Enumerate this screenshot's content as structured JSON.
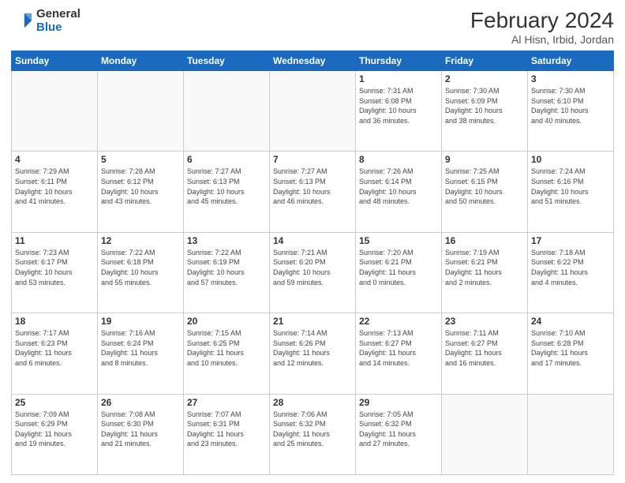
{
  "logo": {
    "general": "General",
    "blue": "Blue"
  },
  "title": "February 2024",
  "subtitle": "Al Hisn, Irbid, Jordan",
  "weekdays": [
    "Sunday",
    "Monday",
    "Tuesday",
    "Wednesday",
    "Thursday",
    "Friday",
    "Saturday"
  ],
  "weeks": [
    [
      {
        "day": "",
        "info": ""
      },
      {
        "day": "",
        "info": ""
      },
      {
        "day": "",
        "info": ""
      },
      {
        "day": "",
        "info": ""
      },
      {
        "day": "1",
        "info": "Sunrise: 7:31 AM\nSunset: 6:08 PM\nDaylight: 10 hours\nand 36 minutes."
      },
      {
        "day": "2",
        "info": "Sunrise: 7:30 AM\nSunset: 6:09 PM\nDaylight: 10 hours\nand 38 minutes."
      },
      {
        "day": "3",
        "info": "Sunrise: 7:30 AM\nSunset: 6:10 PM\nDaylight: 10 hours\nand 40 minutes."
      }
    ],
    [
      {
        "day": "4",
        "info": "Sunrise: 7:29 AM\nSunset: 6:11 PM\nDaylight: 10 hours\nand 41 minutes."
      },
      {
        "day": "5",
        "info": "Sunrise: 7:28 AM\nSunset: 6:12 PM\nDaylight: 10 hours\nand 43 minutes."
      },
      {
        "day": "6",
        "info": "Sunrise: 7:27 AM\nSunset: 6:13 PM\nDaylight: 10 hours\nand 45 minutes."
      },
      {
        "day": "7",
        "info": "Sunrise: 7:27 AM\nSunset: 6:13 PM\nDaylight: 10 hours\nand 46 minutes."
      },
      {
        "day": "8",
        "info": "Sunrise: 7:26 AM\nSunset: 6:14 PM\nDaylight: 10 hours\nand 48 minutes."
      },
      {
        "day": "9",
        "info": "Sunrise: 7:25 AM\nSunset: 6:15 PM\nDaylight: 10 hours\nand 50 minutes."
      },
      {
        "day": "10",
        "info": "Sunrise: 7:24 AM\nSunset: 6:16 PM\nDaylight: 10 hours\nand 51 minutes."
      }
    ],
    [
      {
        "day": "11",
        "info": "Sunrise: 7:23 AM\nSunset: 6:17 PM\nDaylight: 10 hours\nand 53 minutes."
      },
      {
        "day": "12",
        "info": "Sunrise: 7:22 AM\nSunset: 6:18 PM\nDaylight: 10 hours\nand 55 minutes."
      },
      {
        "day": "13",
        "info": "Sunrise: 7:22 AM\nSunset: 6:19 PM\nDaylight: 10 hours\nand 57 minutes."
      },
      {
        "day": "14",
        "info": "Sunrise: 7:21 AM\nSunset: 6:20 PM\nDaylight: 10 hours\nand 59 minutes."
      },
      {
        "day": "15",
        "info": "Sunrise: 7:20 AM\nSunset: 6:21 PM\nDaylight: 11 hours\nand 0 minutes."
      },
      {
        "day": "16",
        "info": "Sunrise: 7:19 AM\nSunset: 6:21 PM\nDaylight: 11 hours\nand 2 minutes."
      },
      {
        "day": "17",
        "info": "Sunrise: 7:18 AM\nSunset: 6:22 PM\nDaylight: 11 hours\nand 4 minutes."
      }
    ],
    [
      {
        "day": "18",
        "info": "Sunrise: 7:17 AM\nSunset: 6:23 PM\nDaylight: 11 hours\nand 6 minutes."
      },
      {
        "day": "19",
        "info": "Sunrise: 7:16 AM\nSunset: 6:24 PM\nDaylight: 11 hours\nand 8 minutes."
      },
      {
        "day": "20",
        "info": "Sunrise: 7:15 AM\nSunset: 6:25 PM\nDaylight: 11 hours\nand 10 minutes."
      },
      {
        "day": "21",
        "info": "Sunrise: 7:14 AM\nSunset: 6:26 PM\nDaylight: 11 hours\nand 12 minutes."
      },
      {
        "day": "22",
        "info": "Sunrise: 7:13 AM\nSunset: 6:27 PM\nDaylight: 11 hours\nand 14 minutes."
      },
      {
        "day": "23",
        "info": "Sunrise: 7:11 AM\nSunset: 6:27 PM\nDaylight: 11 hours\nand 16 minutes."
      },
      {
        "day": "24",
        "info": "Sunrise: 7:10 AM\nSunset: 6:28 PM\nDaylight: 11 hours\nand 17 minutes."
      }
    ],
    [
      {
        "day": "25",
        "info": "Sunrise: 7:09 AM\nSunset: 6:29 PM\nDaylight: 11 hours\nand 19 minutes."
      },
      {
        "day": "26",
        "info": "Sunrise: 7:08 AM\nSunset: 6:30 PM\nDaylight: 11 hours\nand 21 minutes."
      },
      {
        "day": "27",
        "info": "Sunrise: 7:07 AM\nSunset: 6:31 PM\nDaylight: 11 hours\nand 23 minutes."
      },
      {
        "day": "28",
        "info": "Sunrise: 7:06 AM\nSunset: 6:32 PM\nDaylight: 11 hours\nand 25 minutes."
      },
      {
        "day": "29",
        "info": "Sunrise: 7:05 AM\nSunset: 6:32 PM\nDaylight: 11 hours\nand 27 minutes."
      },
      {
        "day": "",
        "info": ""
      },
      {
        "day": "",
        "info": ""
      }
    ]
  ]
}
